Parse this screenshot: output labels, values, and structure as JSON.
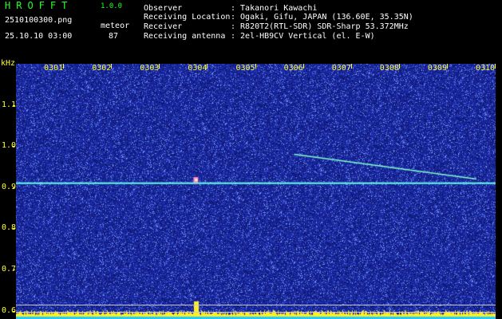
{
  "header": {
    "app_title": "HROFFT",
    "version": "1.0.0",
    "file_name": "2510100300.png",
    "datetime": "25.10.10 03:00",
    "mode_label": "meteor",
    "count": "87"
  },
  "info": [
    {
      "key": "Observer",
      "value": ": Takanori Kawachi"
    },
    {
      "key": "Receiving Location",
      "value": ": Ogaki, Gifu, JAPAN (136.60E, 35.35N)"
    },
    {
      "key": "Receiver",
      "value": ": R820T2(RTL-SDR) SDR-Sharp 53.372MHz"
    },
    {
      "key": "Receiving antenna",
      "value": ": 2el-HB9CV Vertical (el. E-W)"
    }
  ],
  "colors": {
    "label_green": "#22ff22",
    "label_white": "#ffffff",
    "axis_yellow": "#ffff33",
    "background_blue": "#1a2a9a",
    "carrier_cyan": "#66ffee"
  },
  "chart_data": {
    "type": "heatmap",
    "y_unit": "kHz",
    "y_ticks": [
      "1.1",
      "1.0",
      "0.9",
      "0.8",
      "0.7",
      "0.6"
    ],
    "ylim": [
      0.58,
      1.2
    ],
    "x_ticks": [
      "0301",
      "0302",
      "0303",
      "0304",
      "0305",
      "0306",
      "0307",
      "0308",
      "0309",
      "0310"
    ],
    "xlim_minutes": [
      0,
      10
    ],
    "carrier_khz": 0.91,
    "meteor_echoes": [
      {
        "minute": 3.75,
        "khz": 0.915
      },
      {
        "minute": 5.8,
        "khz": 0.98,
        "end_minute": 9.6,
        "end_khz": 0.92
      }
    ],
    "reference_lines_khz": [
      0.615,
      0.598
    ]
  }
}
